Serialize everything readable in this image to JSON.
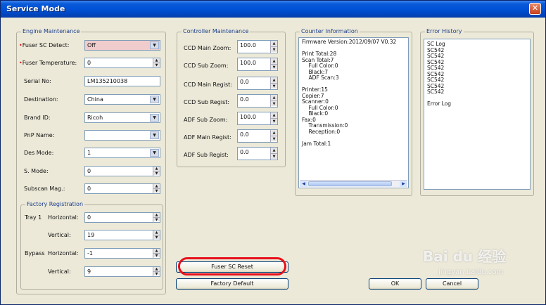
{
  "window": {
    "title": "Service Mode",
    "close_glyph": "✕"
  },
  "engine": {
    "title": "Engine Maintenance",
    "fields": [
      {
        "label": "Fuser SC Detect:",
        "value": "Off",
        "control": "dropdown",
        "required": true
      },
      {
        "label": "Fuser Temperature:",
        "value": "0",
        "control": "spinner",
        "required": true
      },
      {
        "label": "Serial No:",
        "value": "LM135210038",
        "control": "text"
      },
      {
        "label": "Destination:",
        "value": "China",
        "control": "dropdown"
      },
      {
        "label": "Brand ID:",
        "value": "Ricoh",
        "control": "dropdown"
      },
      {
        "label": "PnP Name:",
        "value": "",
        "control": "dropdown"
      },
      {
        "label": "Des Mode:",
        "value": "1",
        "control": "dropdown"
      },
      {
        "label": "S. Mode:",
        "value": "0",
        "control": "spinner"
      },
      {
        "label": "Subscan Mag.:",
        "value": "0",
        "control": "spinner"
      }
    ],
    "factory": {
      "title": "Factory Registration",
      "tray1_label": "Tray 1",
      "bypass_label": "Bypass",
      "horizontal_label": "Horizontal:",
      "vertical_label": "Vertical:",
      "tray1_horizontal": "0",
      "tray1_vertical": "19",
      "bypass_horizontal": "-1",
      "bypass_vertical": "9"
    }
  },
  "controller": {
    "title": "Controller Maintenance",
    "fields": [
      {
        "label": "CCD Main Zoom:",
        "value": "100.0"
      },
      {
        "label": "CCD Sub Zoom:",
        "value": "100.0"
      },
      {
        "label": "CCD Main Regist:",
        "value": "0.0"
      },
      {
        "label": "CCD Sub Regist:",
        "value": "0.0"
      },
      {
        "label": "ADF Sub Zoom:",
        "value": "100.0"
      },
      {
        "label": "ADF Main Regist:",
        "value": "0.0"
      },
      {
        "label": "ADF Sub Regist:",
        "value": "0.0"
      }
    ]
  },
  "counter": {
    "title": "Counter Information",
    "lines": [
      "Firmware Version:2012/09/07 V0.32",
      "",
      "Print Total:28",
      "Scan Total:7",
      "  Full Color:0",
      "  Black:7",
      "  ADF Scan:3",
      "",
      "Printer:15",
      "Copier:7",
      "Scanner:0",
      "  Full Color:0",
      "  Black:0",
      "Fax:0",
      "  Transmission:0",
      "  Reception:0",
      "",
      "Jam Total:1"
    ]
  },
  "errors": {
    "title": "Error History",
    "lines": [
      "SC Log",
      "SC542",
      "SC542",
      "SC542",
      "SC542",
      "SC542",
      "SC542",
      "SC542",
      "SC542",
      "",
      "Error Log"
    ]
  },
  "buttons": {
    "fuser_reset": "Fuser SC Reset",
    "factory_default": "Factory Default",
    "ok": "OK",
    "cancel": "Cancel"
  },
  "watermark": {
    "text": "Bai du 经验",
    "url": "jingyan.baidu.com"
  },
  "colors": {
    "title_bar": "#0054e3",
    "highlight_outline": "#e8101a",
    "required_marker": "#dd1111"
  }
}
